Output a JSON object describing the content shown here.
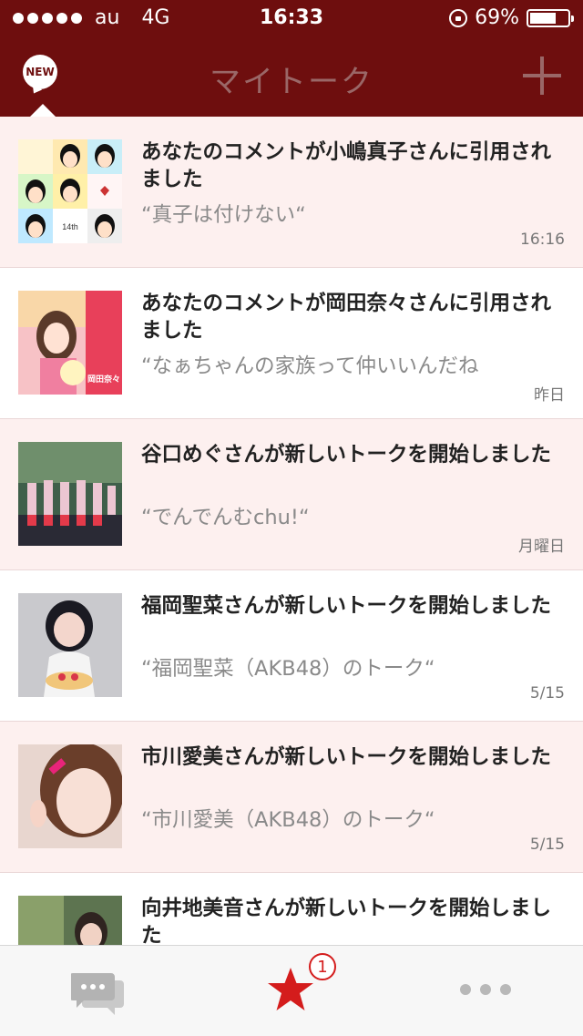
{
  "status_bar": {
    "carrier": "au",
    "network": "4G",
    "time": "16:33",
    "battery": "69%",
    "battery_level": 0.69,
    "signal_dots": 5
  },
  "nav": {
    "title": "マイトーク",
    "new_badge": "NEW",
    "bg_color": "#6e0e0e"
  },
  "talks": [
    {
      "title": "あなたのコメントが小嶋真子さんに引用されました",
      "quote": "“真子は付けない“",
      "date": "16:16",
      "thumb_text": "14th",
      "thumb_icon": "tiled-avatar-grid"
    },
    {
      "title": "あなたのコメントが岡田奈々さんに引用されました",
      "quote": "“なぁちゃんの家族って仲いいんだね",
      "date": "昨日",
      "thumb_text": "岡田奈々",
      "thumb_icon": "portrait-photo"
    },
    {
      "title": "谷口めぐさんが新しいトークを開始しました",
      "quote": "“でんでんむchu!“",
      "date": "月曜日",
      "thumb_icon": "stage-group-photo"
    },
    {
      "title": "福岡聖菜さんが新しいトークを開始しました",
      "quote": "“福岡聖菜（AKB48）のトーク“",
      "date": "5/15",
      "thumb_icon": "portrait-photo"
    },
    {
      "title": "市川愛美さんが新しいトークを開始しました",
      "quote": "“市川愛美（AKB48）のトーク“",
      "date": "5/15",
      "thumb_icon": "selfie-photo"
    },
    {
      "title": "向井地美音さんが新しいトークを開始しました",
      "quote": "",
      "date": "",
      "thumb_icon": "outdoor-photo"
    }
  ],
  "tabbar": {
    "tabs": [
      {
        "name": "talk",
        "icon": "chat-bubbles-icon"
      },
      {
        "name": "favorites",
        "icon": "star-icon",
        "badge": "1"
      },
      {
        "name": "more",
        "icon": "more-dots-icon"
      }
    ],
    "accent": "#d41c1c"
  }
}
